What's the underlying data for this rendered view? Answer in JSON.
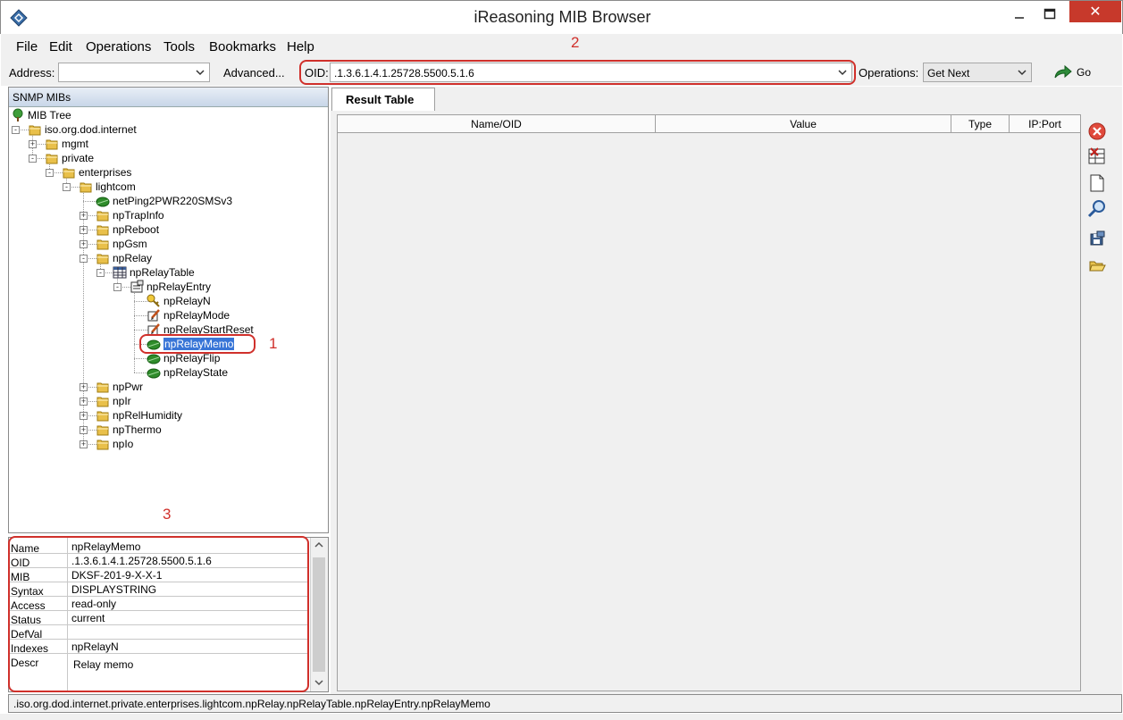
{
  "window": {
    "title": "iReasoning MIB Browser",
    "controls": {
      "minimize": "—",
      "maximize": "☐",
      "close": "✕"
    }
  },
  "menu": [
    "File",
    "Edit",
    "Operations",
    "Tools",
    "Bookmarks",
    "Help"
  ],
  "toolbar": {
    "address_label": "Address:",
    "address_value": "",
    "advanced_label": "Advanced...",
    "oid_label": "OID:",
    "oid_value": ".1.3.6.1.4.1.25728.5500.5.1.6",
    "operations_label": "Operations:",
    "operations_value": "Get Next",
    "go_label": "Go"
  },
  "annotations": {
    "one": "1",
    "two": "2",
    "three": "3"
  },
  "left_panel": {
    "header": "SNMP MIBs",
    "tree": [
      {
        "label": "MIB Tree",
        "icon": "tree-icon"
      },
      {
        "label": "iso.org.dod.internet",
        "icon": "folder-icon"
      },
      {
        "label": "mgmt",
        "icon": "folder-icon"
      },
      {
        "label": "private",
        "icon": "folder-icon"
      },
      {
        "label": "enterprises",
        "icon": "folder-icon"
      },
      {
        "label": "lightcom",
        "icon": "folder-icon"
      },
      {
        "label": "netPing2PWR220SMSv3",
        "icon": "leaf-icon"
      },
      {
        "label": "npTrapInfo",
        "icon": "folder-icon"
      },
      {
        "label": "npReboot",
        "icon": "folder-icon"
      },
      {
        "label": "npGsm",
        "icon": "folder-icon"
      },
      {
        "label": "npRelay",
        "icon": "folder-icon"
      },
      {
        "label": "npRelayTable",
        "icon": "table-icon"
      },
      {
        "label": "npRelayEntry",
        "icon": "entry-icon"
      },
      {
        "label": "npRelayN",
        "icon": "key-icon"
      },
      {
        "label": "npRelayMode",
        "icon": "writable-icon"
      },
      {
        "label": "npRelayStartReset",
        "icon": "writable-icon"
      },
      {
        "label": "npRelayMemo",
        "icon": "leaf-icon"
      },
      {
        "label": "npRelayFlip",
        "icon": "leaf-icon"
      },
      {
        "label": "npRelayState",
        "icon": "leaf-icon"
      },
      {
        "label": "npPwr",
        "icon": "folder-icon"
      },
      {
        "label": "npIr",
        "icon": "folder-icon"
      },
      {
        "label": "npRelHumidity",
        "icon": "folder-icon"
      },
      {
        "label": "npThermo",
        "icon": "folder-icon"
      },
      {
        "label": "npIo",
        "icon": "folder-icon"
      }
    ]
  },
  "properties": [
    {
      "key": "Name",
      "value": "npRelayMemo"
    },
    {
      "key": "OID",
      "value": ".1.3.6.1.4.1.25728.5500.5.1.6"
    },
    {
      "key": "MIB",
      "value": "DKSF-201-9-X-X-1"
    },
    {
      "key": "Syntax",
      "value": "DISPLAYSTRING"
    },
    {
      "key": "Access",
      "value": "read-only"
    },
    {
      "key": "Status",
      "value": "current"
    },
    {
      "key": "DefVal",
      "value": ""
    },
    {
      "key": "Indexes",
      "value": "npRelayN"
    },
    {
      "key": "Descr",
      "value": "Relay memo"
    }
  ],
  "result": {
    "tab": "Result Table",
    "columns": [
      "Name/OID",
      "Value",
      "Type",
      "IP:Port"
    ]
  },
  "status_bar": ".iso.org.dod.internet.private.enterprises.lightcom.npRelay.npRelayTable.npRelayEntry.npRelayMemo",
  "colors": {
    "annotation": "#d0302b",
    "selection": "#3875d7",
    "close_button": "#c7392b"
  }
}
